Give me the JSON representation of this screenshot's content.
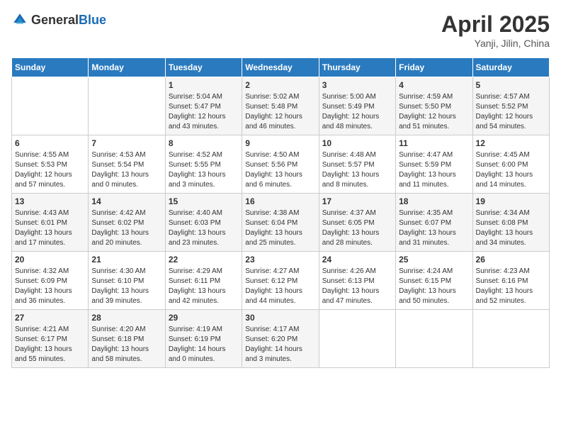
{
  "header": {
    "logo_general": "General",
    "logo_blue": "Blue",
    "title": "April 2025",
    "subtitle": "Yanji, Jilin, China"
  },
  "calendar": {
    "weekdays": [
      "Sunday",
      "Monday",
      "Tuesday",
      "Wednesday",
      "Thursday",
      "Friday",
      "Saturday"
    ],
    "weeks": [
      [
        {
          "day": "",
          "sunrise": "",
          "sunset": "",
          "daylight": "",
          "empty": true
        },
        {
          "day": "",
          "sunrise": "",
          "sunset": "",
          "daylight": "",
          "empty": true
        },
        {
          "day": "1",
          "sunrise": "Sunrise: 5:04 AM",
          "sunset": "Sunset: 5:47 PM",
          "daylight": "Daylight: 12 hours and 43 minutes.",
          "empty": false
        },
        {
          "day": "2",
          "sunrise": "Sunrise: 5:02 AM",
          "sunset": "Sunset: 5:48 PM",
          "daylight": "Daylight: 12 hours and 46 minutes.",
          "empty": false
        },
        {
          "day": "3",
          "sunrise": "Sunrise: 5:00 AM",
          "sunset": "Sunset: 5:49 PM",
          "daylight": "Daylight: 12 hours and 48 minutes.",
          "empty": false
        },
        {
          "day": "4",
          "sunrise": "Sunrise: 4:59 AM",
          "sunset": "Sunset: 5:50 PM",
          "daylight": "Daylight: 12 hours and 51 minutes.",
          "empty": false
        },
        {
          "day": "5",
          "sunrise": "Sunrise: 4:57 AM",
          "sunset": "Sunset: 5:52 PM",
          "daylight": "Daylight: 12 hours and 54 minutes.",
          "empty": false
        }
      ],
      [
        {
          "day": "6",
          "sunrise": "Sunrise: 4:55 AM",
          "sunset": "Sunset: 5:53 PM",
          "daylight": "Daylight: 12 hours and 57 minutes.",
          "empty": false
        },
        {
          "day": "7",
          "sunrise": "Sunrise: 4:53 AM",
          "sunset": "Sunset: 5:54 PM",
          "daylight": "Daylight: 13 hours and 0 minutes.",
          "empty": false
        },
        {
          "day": "8",
          "sunrise": "Sunrise: 4:52 AM",
          "sunset": "Sunset: 5:55 PM",
          "daylight": "Daylight: 13 hours and 3 minutes.",
          "empty": false
        },
        {
          "day": "9",
          "sunrise": "Sunrise: 4:50 AM",
          "sunset": "Sunset: 5:56 PM",
          "daylight": "Daylight: 13 hours and 6 minutes.",
          "empty": false
        },
        {
          "day": "10",
          "sunrise": "Sunrise: 4:48 AM",
          "sunset": "Sunset: 5:57 PM",
          "daylight": "Daylight: 13 hours and 8 minutes.",
          "empty": false
        },
        {
          "day": "11",
          "sunrise": "Sunrise: 4:47 AM",
          "sunset": "Sunset: 5:59 PM",
          "daylight": "Daylight: 13 hours and 11 minutes.",
          "empty": false
        },
        {
          "day": "12",
          "sunrise": "Sunrise: 4:45 AM",
          "sunset": "Sunset: 6:00 PM",
          "daylight": "Daylight: 13 hours and 14 minutes.",
          "empty": false
        }
      ],
      [
        {
          "day": "13",
          "sunrise": "Sunrise: 4:43 AM",
          "sunset": "Sunset: 6:01 PM",
          "daylight": "Daylight: 13 hours and 17 minutes.",
          "empty": false
        },
        {
          "day": "14",
          "sunrise": "Sunrise: 4:42 AM",
          "sunset": "Sunset: 6:02 PM",
          "daylight": "Daylight: 13 hours and 20 minutes.",
          "empty": false
        },
        {
          "day": "15",
          "sunrise": "Sunrise: 4:40 AM",
          "sunset": "Sunset: 6:03 PM",
          "daylight": "Daylight: 13 hours and 23 minutes.",
          "empty": false
        },
        {
          "day": "16",
          "sunrise": "Sunrise: 4:38 AM",
          "sunset": "Sunset: 6:04 PM",
          "daylight": "Daylight: 13 hours and 25 minutes.",
          "empty": false
        },
        {
          "day": "17",
          "sunrise": "Sunrise: 4:37 AM",
          "sunset": "Sunset: 6:05 PM",
          "daylight": "Daylight: 13 hours and 28 minutes.",
          "empty": false
        },
        {
          "day": "18",
          "sunrise": "Sunrise: 4:35 AM",
          "sunset": "Sunset: 6:07 PM",
          "daylight": "Daylight: 13 hours and 31 minutes.",
          "empty": false
        },
        {
          "day": "19",
          "sunrise": "Sunrise: 4:34 AM",
          "sunset": "Sunset: 6:08 PM",
          "daylight": "Daylight: 13 hours and 34 minutes.",
          "empty": false
        }
      ],
      [
        {
          "day": "20",
          "sunrise": "Sunrise: 4:32 AM",
          "sunset": "Sunset: 6:09 PM",
          "daylight": "Daylight: 13 hours and 36 minutes.",
          "empty": false
        },
        {
          "day": "21",
          "sunrise": "Sunrise: 4:30 AM",
          "sunset": "Sunset: 6:10 PM",
          "daylight": "Daylight: 13 hours and 39 minutes.",
          "empty": false
        },
        {
          "day": "22",
          "sunrise": "Sunrise: 4:29 AM",
          "sunset": "Sunset: 6:11 PM",
          "daylight": "Daylight: 13 hours and 42 minutes.",
          "empty": false
        },
        {
          "day": "23",
          "sunrise": "Sunrise: 4:27 AM",
          "sunset": "Sunset: 6:12 PM",
          "daylight": "Daylight: 13 hours and 44 minutes.",
          "empty": false
        },
        {
          "day": "24",
          "sunrise": "Sunrise: 4:26 AM",
          "sunset": "Sunset: 6:13 PM",
          "daylight": "Daylight: 13 hours and 47 minutes.",
          "empty": false
        },
        {
          "day": "25",
          "sunrise": "Sunrise: 4:24 AM",
          "sunset": "Sunset: 6:15 PM",
          "daylight": "Daylight: 13 hours and 50 minutes.",
          "empty": false
        },
        {
          "day": "26",
          "sunrise": "Sunrise: 4:23 AM",
          "sunset": "Sunset: 6:16 PM",
          "daylight": "Daylight: 13 hours and 52 minutes.",
          "empty": false
        }
      ],
      [
        {
          "day": "27",
          "sunrise": "Sunrise: 4:21 AM",
          "sunset": "Sunset: 6:17 PM",
          "daylight": "Daylight: 13 hours and 55 minutes.",
          "empty": false
        },
        {
          "day": "28",
          "sunrise": "Sunrise: 4:20 AM",
          "sunset": "Sunset: 6:18 PM",
          "daylight": "Daylight: 13 hours and 58 minutes.",
          "empty": false
        },
        {
          "day": "29",
          "sunrise": "Sunrise: 4:19 AM",
          "sunset": "Sunset: 6:19 PM",
          "daylight": "Daylight: 14 hours and 0 minutes.",
          "empty": false
        },
        {
          "day": "30",
          "sunrise": "Sunrise: 4:17 AM",
          "sunset": "Sunset: 6:20 PM",
          "daylight": "Daylight: 14 hours and 3 minutes.",
          "empty": false
        },
        {
          "day": "",
          "sunrise": "",
          "sunset": "",
          "daylight": "",
          "empty": true
        },
        {
          "day": "",
          "sunrise": "",
          "sunset": "",
          "daylight": "",
          "empty": true
        },
        {
          "day": "",
          "sunrise": "",
          "sunset": "",
          "daylight": "",
          "empty": true
        }
      ]
    ]
  }
}
